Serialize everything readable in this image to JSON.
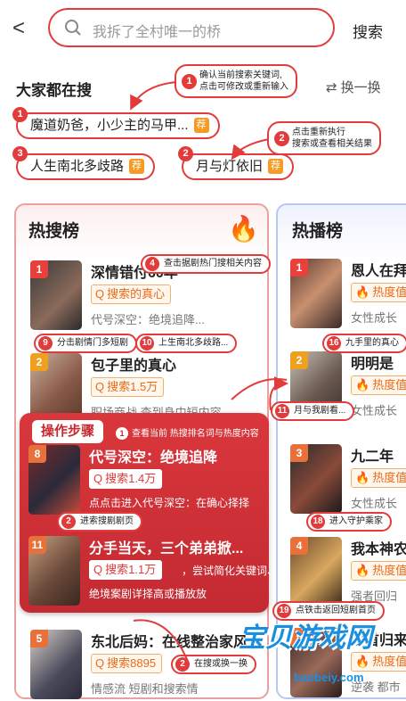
{
  "header": {
    "back": "<",
    "placeholder": "我拆了全村唯一的桥",
    "search_btn": "搜索"
  },
  "everyone": {
    "title": "大家都在搜",
    "refresh": "换一换",
    "chips": [
      {
        "text": "魔道奶爸，小少主的马甲...",
        "tag": "荐",
        "num": "1"
      },
      {
        "text": "人生南北多歧路",
        "tag": "荐",
        "num": "3"
      },
      {
        "text": "月与灯依旧",
        "tag": "荐",
        "num": "2"
      }
    ]
  },
  "callouts": {
    "c1_num": "1",
    "c1_line1": "确认当前搜索关键词,",
    "c1_line2": "点击可修改或重新输入",
    "c2_num": "2",
    "c2_line1": "点击重新执行",
    "c2_line2": "搜索或查看相关结果"
  },
  "hot_search": {
    "title": "热搜榜",
    "items": [
      {
        "rank": "1",
        "title": "深情错付60年",
        "badge": "搜索的真心",
        "desc": "代号深空：绝境追降..."
      },
      {
        "rank": "2",
        "title": "包子里的真心",
        "badge": "搜索1.5万",
        "desc": "职场商战 查到身中短内容"
      }
    ]
  },
  "hot_play": {
    "title": "热播榜",
    "items": [
      {
        "rank": "1",
        "title": "恩人在拜",
        "badge": "热度值",
        "desc": "女性成长"
      },
      {
        "rank": "2",
        "title": "明明是",
        "badge": "热度值",
        "desc": "女性成长"
      },
      {
        "rank": "3",
        "title": "九二年",
        "badge": "热度值",
        "desc": "女性成长"
      },
      {
        "rank": "4",
        "title": "我本神农",
        "badge": "热度值",
        "desc": "强者回归"
      },
      {
        "rank": "5",
        "title": "龙首归来",
        "badge": "热度值",
        "desc": "逆袭 都市"
      }
    ]
  },
  "operation": {
    "header": "操作步骤",
    "sub_num": "1",
    "sub": "查看当前 热搜排名词与热度内容",
    "items": [
      {
        "rank": "8",
        "title": "代号深空：绝境追降",
        "badge": "搜索1.4万",
        "desc": "点点击进入代号深空：在确心择择"
      },
      {
        "rank": "11",
        "title": "分手当天，三个弟弟掀...",
        "badge": "搜索1.1万",
        "desc": "，尝试简化关键词、",
        "desc2": "绝境案剧详择高或播放放"
      }
    ]
  },
  "bottom_item": {
    "rank": "5",
    "title": "东北后妈：在线整治家风",
    "badge": "搜索8895",
    "desc": "情感流 短剧和搜索情"
  },
  "pills": [
    {
      "num": "4",
      "text": "查击据剧热门搜相关内容"
    },
    {
      "num": "9",
      "text": "分击剧情门多短剧"
    },
    {
      "num": "10",
      "text": "上生南北多歧路..."
    },
    {
      "num": "16",
      "text": "九手里的真心"
    },
    {
      "num": "11",
      "text": "月与我剧看..."
    },
    {
      "num": "2",
      "text": "进索搜剧剧页"
    },
    {
      "num": "18",
      "text": "进入守护乘家"
    },
    {
      "num": "19",
      "text": "点铁击返回短剧首页"
    },
    {
      "num": "2",
      "text": "在搜或换一换"
    }
  ],
  "watermark": {
    "main": "宝贝游戏网",
    "sub": "baobeiy.com"
  },
  "colors": {
    "accent": "#e23b3b",
    "badge": "#e86b1a"
  }
}
